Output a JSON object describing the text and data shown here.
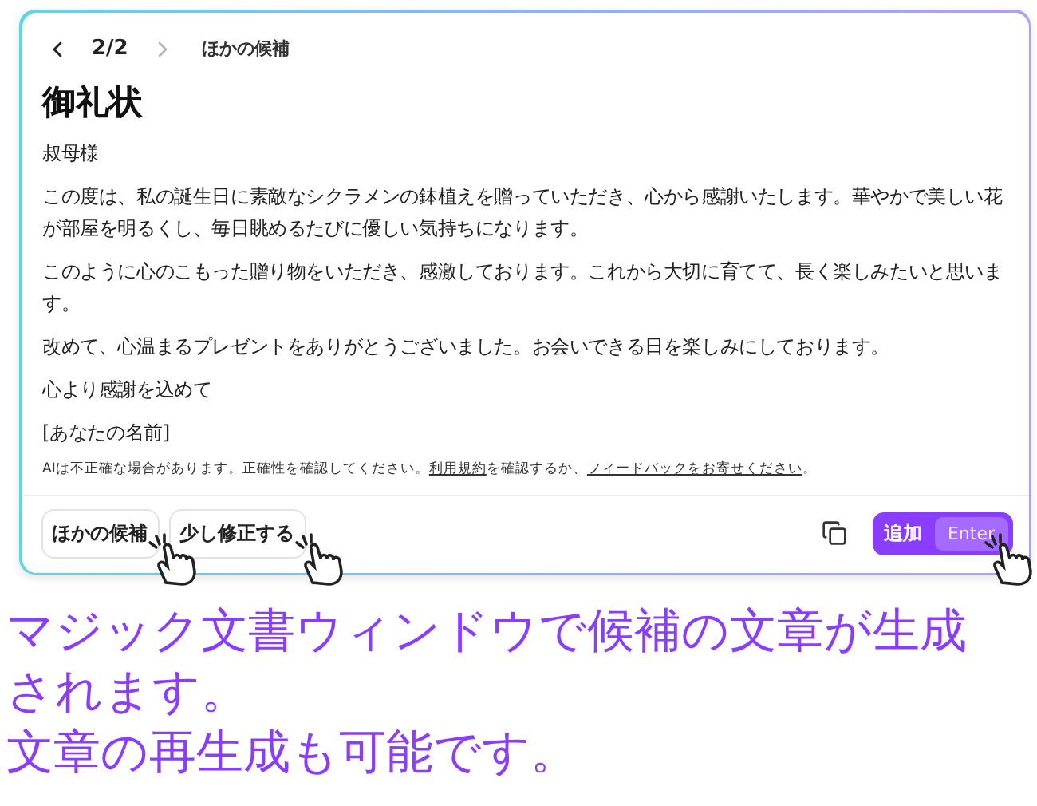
{
  "nav": {
    "prev": {
      "disabled": false
    },
    "next": {
      "disabled": true
    },
    "counter": "2/2",
    "label": "ほかの候補"
  },
  "document": {
    "title": "御礼状",
    "paragraphs": [
      "叔母様",
      "この度は、私の誕生日に素敵なシクラメンの鉢植えを贈っていただき、心から感謝いたします。華やかで美しい花が部屋を明るくし、毎日眺めるたびに優しい気持ちになります。",
      "このように心のこもった贈り物をいただき、感激しております。これから大切に育てて、長く楽しみたいと思います。",
      "改めて、心温まるプレゼントをありがとうございました。お会いできる日を楽しみにしております。",
      "心より感謝を込めて",
      "[あなたの名前]"
    ]
  },
  "disclaimer": [
    {
      "kind": "text",
      "text": "AIは不正確な場合があります。正確性を確認してください。"
    },
    {
      "kind": "link",
      "text": "利用規約"
    },
    {
      "kind": "text",
      "text": "を確認するか、"
    },
    {
      "kind": "link",
      "text": "フィードバックをお寄せください"
    },
    {
      "kind": "text",
      "text": "。"
    }
  ],
  "footer": {
    "buttons": [
      "ほかの候補",
      "少し修正する"
    ],
    "add": {
      "label": "追加",
      "key": "Enter"
    }
  },
  "caption": [
    "マジック文書ウィンドウで候補の文章が生成されます。",
    "文章の再生成も可能です。"
  ]
}
